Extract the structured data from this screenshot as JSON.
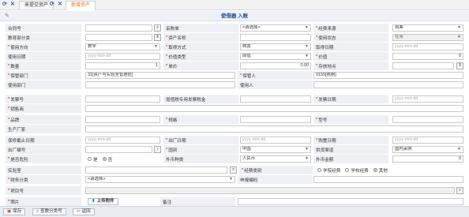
{
  "tabs": {
    "refresh_icon": "refresh-icon",
    "close_icon": "close-icon",
    "items": [
      {
        "label": "来提交资产"
      },
      {
        "label": "新增资产"
      }
    ]
  },
  "form": {
    "title": "使借器 入账",
    "fields": {
      "contract_no": {
        "label": "合同号",
        "value": ""
      },
      "purchase_order": {
        "label": "采购单",
        "value": ""
      },
      "purpose_select": {
        "value": "<请选择>"
      },
      "funding_source": {
        "label": "经费来源",
        "value": "自筹"
      },
      "education_category": {
        "label": "教育部分类",
        "value": ""
      },
      "asset_name": {
        "label": "资产名称",
        "value": ""
      },
      "use_status": {
        "label": "使用状态",
        "value": "在用"
      },
      "use_direction": {
        "label": "使用方向",
        "value": "教学"
      },
      "acquire_method": {
        "label": "取得方式",
        "value": "购置"
      },
      "acquire_date": {
        "label": "取得日期",
        "value": "",
        "placeholder": "yyyy-mm-dd"
      },
      "use_date": {
        "label": "使用日期",
        "value": "",
        "placeholder": "yyyy-mm-dd"
      },
      "value_type": {
        "label": "价值类型",
        "value": "原值"
      },
      "value": {
        "label": "价值",
        "value": "0"
      },
      "quantity": {
        "label": "数量",
        "value": "1"
      },
      "unit_price": {
        "label": "单价",
        "value": "0.00"
      },
      "storage_location": {
        "label": "存放地点",
        "value": ""
      },
      "custody_dept": {
        "label": "保管部门",
        "value": "31[资产与实验室管理处]"
      },
      "custodian": {
        "label": "保管人",
        "value": "9155[陈刚]"
      },
      "use_dept": {
        "label": "使用部门",
        "value": ""
      },
      "user": {
        "label": "使用人",
        "value": ""
      },
      "invoice_no": {
        "label": "发票号",
        "value": ""
      },
      "vat_tax_amount": {
        "label": "增值税专用发票税金",
        "value": ""
      },
      "invoice_date": {
        "label": "发票日期",
        "value": "",
        "placeholder": "yyyy-mm-dd"
      },
      "vendor": {
        "label": "销售商",
        "value": ""
      },
      "brand": {
        "label": "品牌",
        "value": ""
      },
      "spec": {
        "label": "规格",
        "value": ""
      },
      "model": {
        "label": "型号",
        "value": ""
      },
      "manufacturer": {
        "label": "生产厂家",
        "value": ""
      },
      "warranty_date": {
        "label": "保修截止日期",
        "value": "",
        "placeholder": "yyyy-mm-dd"
      },
      "factory_date": {
        "label": "出厂日期",
        "value": "",
        "placeholder": "yyyy-mm-dd"
      },
      "purchase_date": {
        "label": "购置日期",
        "value": "",
        "placeholder": "yyyy-mm-dd"
      },
      "factory_no": {
        "label": "出厂编号",
        "value": ""
      },
      "country": {
        "label": "国别",
        "value": "中国"
      },
      "supply_channel": {
        "label": "供货渠道",
        "value": "国内采购"
      },
      "is_dangerous": {
        "label": "是否危险",
        "options": [
          "是",
          "否"
        ],
        "selected": "否"
      },
      "foreign_currency": {
        "label": "外币种类",
        "value": "人民币"
      },
      "foreign_amount": {
        "label": "外币金额",
        "value": "0"
      },
      "lab": {
        "label": "实验室",
        "value": ""
      },
      "funding_category": {
        "label": "经费类别",
        "options": [
          "学院经费",
          "学校经费",
          "其他"
        ],
        "selected": "其他"
      },
      "finance_category": {
        "label": "财务分类",
        "value": "<请选择>"
      },
      "declare_code": {
        "label": "申报编码",
        "value": ""
      },
      "project_no": {
        "label": "项目号",
        "value": ""
      },
      "photo": {
        "label": "照片",
        "upload_label": "上传附件"
      },
      "remarks": {
        "label": "备注",
        "value": ""
      }
    }
  },
  "footer": {
    "save_label": "保存",
    "category_label": "查教分类号",
    "back_label": "返回"
  }
}
